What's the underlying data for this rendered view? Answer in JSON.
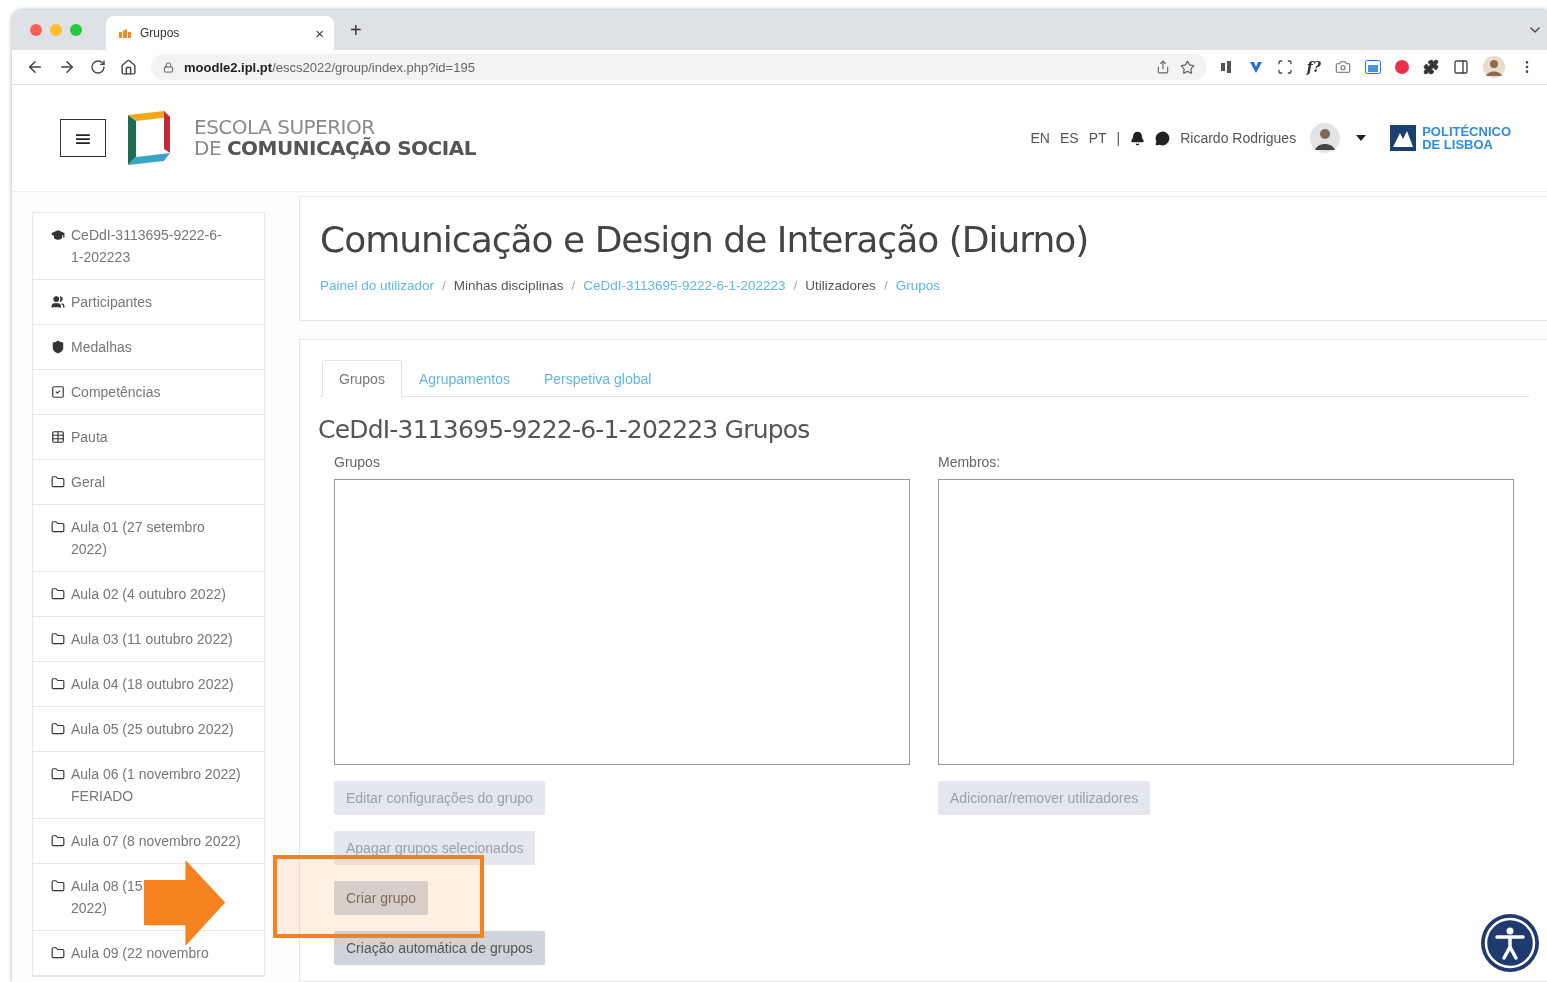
{
  "browser": {
    "tab_title": "Grupos",
    "tab_close": "×",
    "new_tab": "+",
    "url_host": "moodle2.ipl.pt",
    "url_path": "/escs2022/group/index.php?id=195",
    "extension_text": "f?"
  },
  "header": {
    "menu_glyph": "≡",
    "school_line1": "ESCOLA SUPERIOR",
    "school_line2": "DE **COMUNICAÇÃO SOCIAL**",
    "languages": [
      "EN",
      "ES",
      "PT"
    ],
    "separator": "|",
    "user_name": "Ricardo Rodrigues",
    "partner_line1": "POLITÉCNICO",
    "partner_line2": "DE LISBOA"
  },
  "sidebar": {
    "items": [
      {
        "kind": "course",
        "lines": [
          "CeDdI-3113695-9222-6-",
          "1-202223"
        ]
      },
      {
        "kind": "participants",
        "lines": [
          "Participantes"
        ]
      },
      {
        "kind": "badges",
        "lines": [
          "Medalhas"
        ]
      },
      {
        "kind": "competencies",
        "lines": [
          "Competências"
        ]
      },
      {
        "kind": "grades",
        "lines": [
          "Pauta"
        ]
      },
      {
        "kind": "section",
        "lines": [
          "Geral"
        ]
      },
      {
        "kind": "section",
        "lines": [
          "Aula 01 (27 setembro",
          "2022)"
        ]
      },
      {
        "kind": "section",
        "lines": [
          "Aula 02 (4 outubro 2022)"
        ]
      },
      {
        "kind": "section",
        "lines": [
          "Aula 03 (11 outubro 2022)"
        ]
      },
      {
        "kind": "section",
        "lines": [
          "Aula 04 (18 outubro 2022)"
        ]
      },
      {
        "kind": "section",
        "lines": [
          "Aula 05 (25 outubro 2022)"
        ]
      },
      {
        "kind": "section",
        "lines": [
          "Aula 06 (1 novembro 2022)",
          "FERIADO"
        ]
      },
      {
        "kind": "section",
        "lines": [
          "Aula 07 (8 novembro 2022)"
        ]
      },
      {
        "kind": "section",
        "lines": [
          "Aula 08 (15",
          "2022)"
        ]
      },
      {
        "kind": "section",
        "lines": [
          "Aula 09 (22 novembro"
        ]
      }
    ]
  },
  "page": {
    "title": "Comunicação e Design de Interação (Diurno)",
    "breadcrumb_separator": "/",
    "breadcrumb": [
      {
        "label": "Painel do utilizador",
        "link": true
      },
      {
        "label": "Minhas disciplinas",
        "link": false
      },
      {
        "label": "CeDdI-3113695-9222-6-1-202223",
        "link": true
      },
      {
        "label": "Utilizadores",
        "link": false
      },
      {
        "label": "Grupos",
        "link": true
      }
    ]
  },
  "tabs": [
    {
      "label": "Grupos",
      "selected": true
    },
    {
      "label": "Agrupamentos",
      "selected": false
    },
    {
      "label": "Perspetiva global",
      "selected": false
    }
  ],
  "groups": {
    "heading": "CeDdI-3113695-9222-6-1-202223 Grupos",
    "groups_label": "Grupos",
    "members_label": "Membros:",
    "left_buttons": [
      {
        "label": "Editar configurações do grupo",
        "disabled": true
      },
      {
        "label": "Apagar grupos selecionados",
        "disabled": true
      },
      {
        "label": "Criar grupo",
        "disabled": false
      },
      {
        "label": "Criação automática de grupos",
        "disabled": false
      }
    ],
    "right_buttons": [
      {
        "label": "Adicionar/remover utilizadores",
        "disabled": true
      }
    ]
  }
}
